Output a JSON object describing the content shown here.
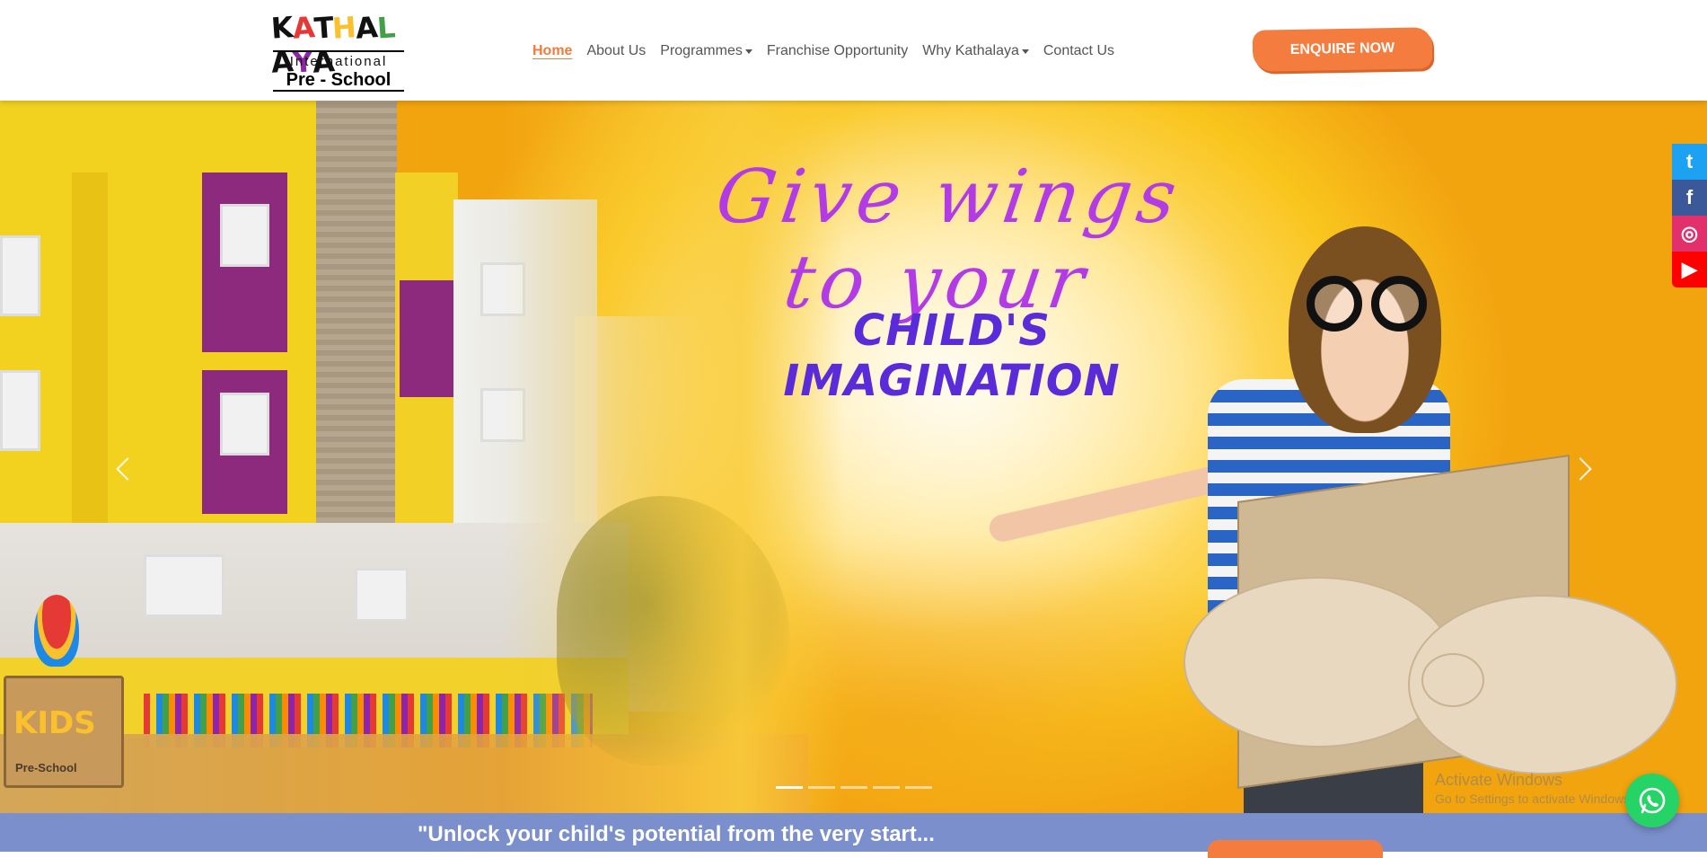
{
  "logo": {
    "kids": "KATHALAYA KIDS",
    "international": "International",
    "preschool": "Pre - School"
  },
  "nav": {
    "items": [
      {
        "label": "Home",
        "active": true,
        "dropdown": false
      },
      {
        "label": "About Us",
        "active": false,
        "dropdown": false
      },
      {
        "label": "Programmes",
        "active": false,
        "dropdown": true
      },
      {
        "label": "Franchise Opportunity",
        "active": false,
        "dropdown": false
      },
      {
        "label": "Why Kathalaya",
        "active": false,
        "dropdown": true
      },
      {
        "label": "Contact Us",
        "active": false,
        "dropdown": false
      }
    ]
  },
  "header": {
    "enquire_label": "ENQUIRE NOW"
  },
  "hero": {
    "line1": "Give wings to your",
    "line2": "CHILD'S IMAGINATION",
    "sign_text": "Pre-School",
    "slide_count": 5,
    "active_slide": 1
  },
  "social": {
    "items": [
      {
        "icon": "twitter-icon",
        "glyph": "t"
      },
      {
        "icon": "facebook-icon",
        "glyph": "f"
      },
      {
        "icon": "instagram-icon",
        "glyph": "◎"
      },
      {
        "icon": "youtube-icon",
        "glyph": "▶"
      }
    ]
  },
  "watermark": {
    "title": "Activate Windows",
    "subtitle": "Go to Settings to activate Windows."
  },
  "band": {
    "text": "\"Unlock your child's potential from the very start..."
  },
  "colors": {
    "accent": "#f47a3c",
    "band": "#7b8fcc",
    "script": "#b33be6",
    "headline": "#5a2bd8",
    "whatsapp": "#25d366"
  }
}
